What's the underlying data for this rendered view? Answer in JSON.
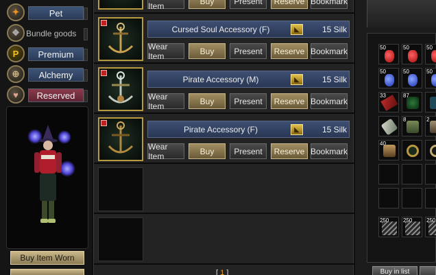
{
  "sidebar": {
    "categories": [
      {
        "label": "Pet",
        "style": "blue",
        "icon": "paw-icon"
      },
      {
        "label": "Bundle goods",
        "style": "plain",
        "icon": "bundle-icon"
      },
      {
        "label": "Premium",
        "style": "blue",
        "icon": "premium-p-icon"
      },
      {
        "label": "Alchemy",
        "style": "blue",
        "icon": "alchemy-icon"
      },
      {
        "label": "Reserved",
        "style": "red",
        "icon": "heart-icon"
      }
    ],
    "buy_item_worn": "Buy Item Worn"
  },
  "items": [
    {
      "name": "",
      "price": "",
      "currency": ""
    },
    {
      "name": "Cursed Soul Accessory (F)",
      "price": "15",
      "currency": "Silk"
    },
    {
      "name": "Pirate Accessory (M)",
      "price": "15",
      "currency": "Silk"
    },
    {
      "name": "Pirate Accessory (F)",
      "price": "15",
      "currency": "Silk"
    }
  ],
  "actions": {
    "wear": "Wear Item",
    "buy": "Buy",
    "present": "Present",
    "reserve": "Reserve",
    "bookmark": "Bookmark"
  },
  "pager": {
    "prev": "[",
    "current": "1",
    "next": "]"
  },
  "inventory": {
    "counts": [
      "50",
      "50",
      "50",
      "50",
      "50",
      "50",
      "33",
      "87",
      "",
      "",
      "8",
      "2",
      "40",
      "",
      "",
      "250",
      "250",
      "250"
    ],
    "button_label": "Buy in list"
  }
}
